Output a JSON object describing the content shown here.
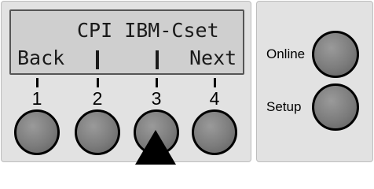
{
  "display": {
    "line1": "CPI IBM-Cset",
    "back_label": "Back",
    "next_label": "Next"
  },
  "keys": [
    {
      "number": "1"
    },
    {
      "number": "2"
    },
    {
      "number": "3"
    },
    {
      "number": "4"
    }
  ],
  "side_buttons": {
    "online_label": "Online",
    "setup_label": "Setup"
  },
  "indicator": {
    "pointed_key": "3"
  },
  "colors": {
    "panel": "#e2e2e2",
    "lcd": "#cfcfcf",
    "button": "#7c7c7c",
    "text": "#000000"
  }
}
